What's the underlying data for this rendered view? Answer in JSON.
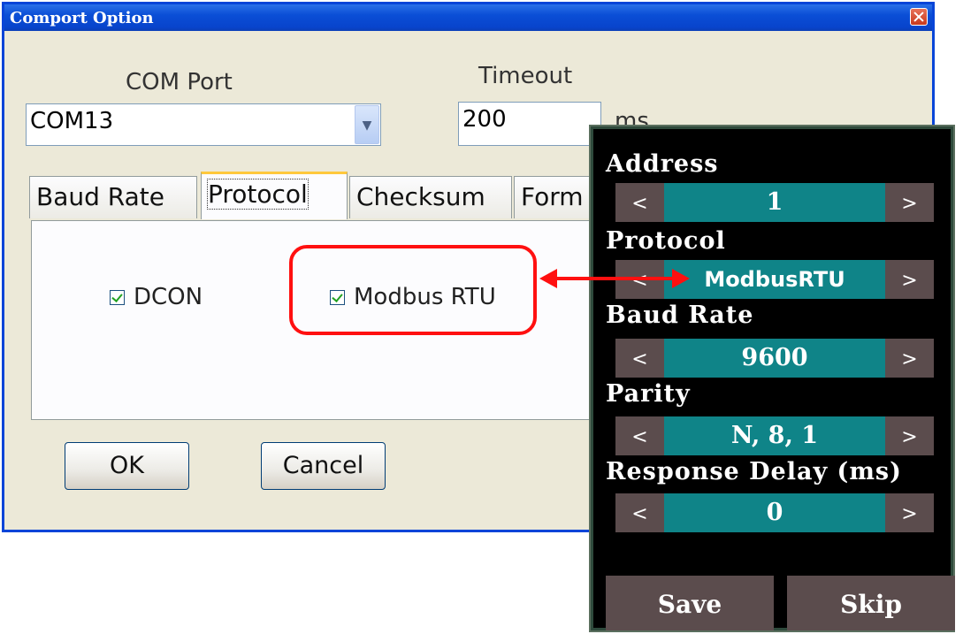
{
  "dialog": {
    "title": "Comport Option",
    "com_port_label": "COM Port",
    "com_port_value": "COM13",
    "timeout_label": "Timeout",
    "timeout_value": "200",
    "timeout_unit": "ms",
    "tabs": [
      "Baud Rate",
      "Protocol",
      "Checksum",
      "Form"
    ],
    "active_tab": "Protocol",
    "checkboxes": [
      {
        "label": "DCON",
        "checked": true
      },
      {
        "label": "Modbus RTU",
        "checked": true
      }
    ],
    "ok_label": "OK",
    "cancel_label": "Cancel"
  },
  "device": {
    "fields": [
      {
        "label": "Address",
        "value": "1"
      },
      {
        "label": "Protocol",
        "value": "ModbusRTU"
      },
      {
        "label": "Baud Rate",
        "value": "9600"
      },
      {
        "label": "Parity",
        "value": "N, 8, 1"
      },
      {
        "label": "Response Delay (ms)",
        "value": "0"
      }
    ],
    "prev_symbol": "<",
    "next_symbol": ">",
    "save_label": "Save",
    "skip_label": "Skip"
  },
  "colors": {
    "highlight": "#ff1010",
    "value_bg": "#0f8488",
    "nav_bg": "#5b4c4d",
    "titlebar": "#0a4ed6"
  }
}
